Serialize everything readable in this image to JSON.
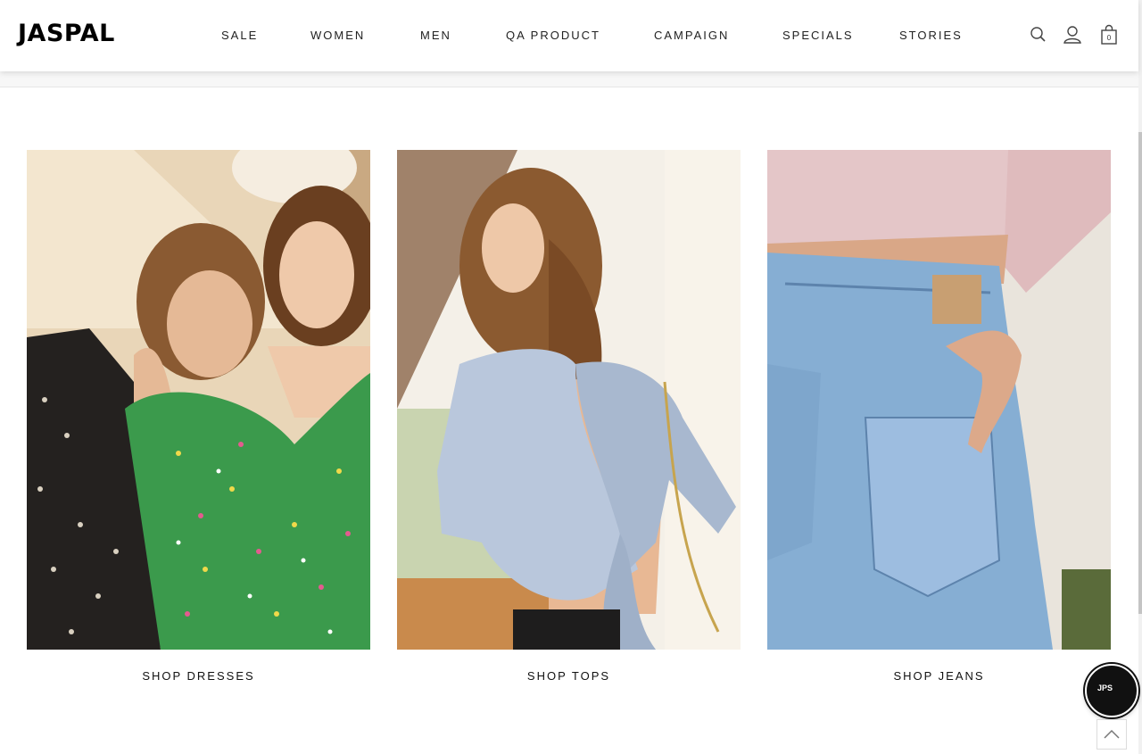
{
  "brand": {
    "logo_text": "JASPAL"
  },
  "nav": {
    "items": [
      {
        "label": "SALE"
      },
      {
        "label": "WOMEN"
      },
      {
        "label": "MEN"
      },
      {
        "label": "QA PRODUCT"
      },
      {
        "label": "CAMPAIGN"
      },
      {
        "label": "SPECIALS"
      },
      {
        "label": "STORIES"
      }
    ]
  },
  "header_icons": {
    "search": "search-icon",
    "account": "user-icon",
    "cart": "shopping-bag-icon",
    "cart_count": "0"
  },
  "tiles": [
    {
      "label": "SHOP DRESSES",
      "image": "two women in floral dresses"
    },
    {
      "label": "SHOP TOPS",
      "image": "woman in light blue open-back top"
    },
    {
      "label": "SHOP JEANS",
      "image": "light wash denim jeans with pink blouse"
    }
  ],
  "chat": {
    "label": "JPS",
    "icon": "chat-bubble-icon"
  },
  "back_to_top": {
    "icon": "chevron-up-icon"
  },
  "colors": {
    "text": "#111111",
    "header_bg": "#ffffff",
    "subbar_bg": "#f7f7f7"
  }
}
